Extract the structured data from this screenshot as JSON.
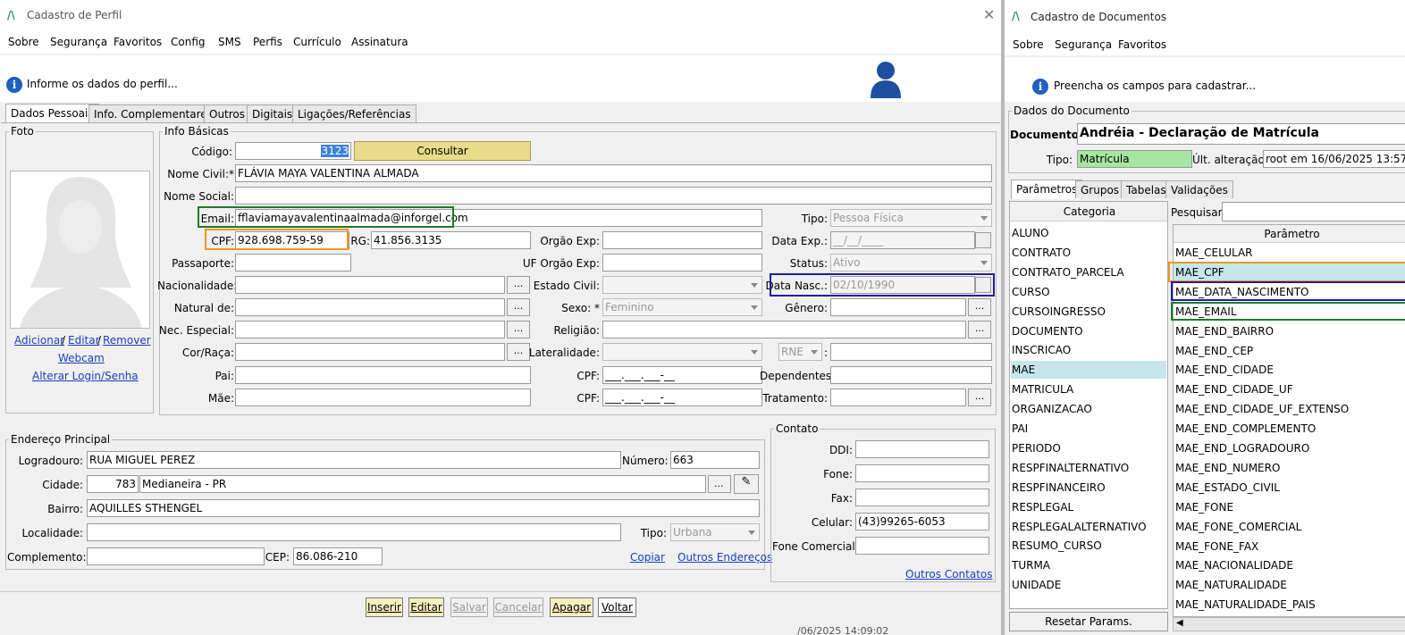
{
  "left": {
    "title": "Cadastro de Perfil",
    "menu": [
      "Sobre",
      "Segurança",
      "Favoritos",
      "Config",
      "SMS",
      "Perfis",
      "Currículo",
      "Assinatura"
    ],
    "info": "Informe os dados do perfil...",
    "tabs": [
      "Dados Pessoais",
      "Info. Complementares",
      "Outros",
      "Digitais",
      "Ligações/Referências"
    ],
    "foto": {
      "label": "Foto",
      "adicionar": "Adicionar",
      "editar": "Editar",
      "remover": "Remover",
      "sep": "/",
      "webcam": "Webcam",
      "alterar": "Alterar Login/Senha"
    },
    "info_basicas": {
      "label": "Info Básicas",
      "codigo_label": "Código:",
      "codigo": "3123",
      "consultar": "Consultar",
      "nome_civil_label": "Nome Civil:*",
      "nome_civil": "FLÁVIA MAYA VALENTINA ALMADA",
      "nome_social_label": "Nome Social:",
      "nome_social": "",
      "email_label": "Email:",
      "email": "fflaviamayavalentinaalmada@inforgel.com",
      "tipo_label": "Tipo:",
      "tipo": "Pessoa Física",
      "cpf_label": "CPF:",
      "cpf": "928.698.759-59",
      "rg_label": "RG:",
      "rg": "41.856.3135",
      "orgao_exp_label": "Orgão Exp:",
      "orgao_exp": "",
      "data_exp_label": "Data Exp.:",
      "data_exp": "__/__/____",
      "passaporte_label": "Passaporte:",
      "passaporte": "",
      "uf_orgao_label": "UF Orgão Exp:",
      "uf_orgao": "",
      "status_label": "Status:",
      "status": "Ativo",
      "nacionalidade_label": "Nacionalidade:",
      "nacionalidade": "",
      "estado_civil_label": "Estado Civil:",
      "estado_civil": "",
      "data_nasc_label": "Data Nasc.:",
      "data_nasc": "02/10/1990",
      "natural_label": "Natural de:",
      "natural": "",
      "sexo_label": "Sexo: *",
      "sexo": "Feminino",
      "genero_label": "Gênero:",
      "genero": "",
      "nec_label": "Nec. Especial:",
      "nec": "",
      "religiao_label": "Religião:",
      "religiao": "",
      "cor_label": "Cor/Raça:",
      "cor": "",
      "lateralidade_label": "Lateralidade:",
      "lateralidade": "",
      "rne": "RNE",
      "rne_sep": ":",
      "pai_label": "Pai:",
      "pai": "",
      "cpf2_label": "CPF:",
      "cpf_mask": "___.___.___-__",
      "dependentes_label": "Dependentes:",
      "mae_label": "Mãe:",
      "mae": "",
      "cpf3_label": "CPF:",
      "tratamento_label": "Tratamento:",
      "dots": "..."
    },
    "endereco": {
      "label": "Endereço Principal",
      "logradouro_label": "Logradouro:",
      "logradouro": "RUA MIGUEL PEREZ",
      "numero_label": "Número:",
      "numero": "663",
      "cidade_label": "Cidade:",
      "cidade_cod": "783",
      "cidade": "Medianeira - PR",
      "bairro_label": "Bairro:",
      "bairro": "AQUILLES STHENGEL",
      "localidade_label": "Localidade:",
      "localidade": "",
      "tipo_label": "Tipo:",
      "tipo": "Urbana",
      "complemento_label": "Complemento:",
      "complemento": "",
      "cep_label": "CEP:",
      "cep": "86.086-210",
      "copiar": "Copiar",
      "outros": "Outros Endereços"
    },
    "contato": {
      "label": "Contato",
      "ddi_label": "DDI:",
      "ddi": "",
      "fone_label": "Fone:",
      "fone": "",
      "fax_label": "Fax:",
      "fax": "",
      "celular_label": "Celular:",
      "celular": "(43)99265-6053",
      "fone_com_label": "Fone Comercial:",
      "fone_com": "",
      "outros": "Outros Contatos"
    },
    "buttons": [
      "Inserir",
      "Editar",
      "Salvar",
      "Cancelar",
      "Apagar",
      "Voltar"
    ],
    "status_fragment": "/06/2025 14:09:02"
  },
  "right": {
    "title": "Cadastro de Documentos",
    "menu": [
      "Sobre",
      "Segurança",
      "Favoritos"
    ],
    "info": "Preencha os campos para cadastrar...",
    "dados_label": "Dados do Documento",
    "documento_label": "Documento:",
    "documento": "Andréia - Declaração de Matrícula",
    "tipo_label": "Tipo:",
    "tipo": "Matrícula",
    "ult_label": "Últ. alteração:",
    "ult": "root em 16/06/2025 13:57",
    "tabs": [
      "Parâmetros",
      "Grupos",
      "Tabelas",
      "Validações"
    ],
    "categoria_header": "Categoria",
    "categorias": [
      "ALUNO",
      "CONTRATO",
      "CONTRATO_PARCELA",
      "CURSO",
      "CURSOINGRESSO",
      "DOCUMENTO",
      "INSCRICAO",
      "MAE",
      "MATRICULA",
      "ORGANIZACAO",
      "PAI",
      "PERIODO",
      "RESPFINALTERNATIVO",
      "RESPFINANCEIRO",
      "RESPLEGAL",
      "RESPLEGALALTERNATIVO",
      "RESUMO_CURSO",
      "TURMA",
      "UNIDADE"
    ],
    "pesquisar_label": "Pesquisar:",
    "parametro_header": "Parâmetro",
    "parametros": [
      "MAE_CELULAR",
      "MAE_CPF",
      "MAE_DATA_NASCIMENTO",
      "MAE_EMAIL",
      "MAE_END_BAIRRO",
      "MAE_END_CEP",
      "MAE_END_CIDADE",
      "MAE_END_CIDADE_UF",
      "MAE_END_CIDADE_UF_EXTENSO",
      "MAE_END_COMPLEMENTO",
      "MAE_END_LOGRADOURO",
      "MAE_END_NUMERO",
      "MAE_ESTADO_CIVIL",
      "MAE_FONE",
      "MAE_FONE_COMERCIAL",
      "MAE_FONE_FAX",
      "MAE_NACIONALIDADE",
      "MAE_NATURALIDADE",
      "MAE_NATURALIDADE_PAIS"
    ],
    "resetar": "Resetar Params."
  },
  "colors": {
    "orange": "#f0961e",
    "blue": "#1e1ea0",
    "green": "#1e7a2a",
    "consultar": "#e8dc8a",
    "tipo_green": "#a6e6a0",
    "selected": "#c6e6ea"
  }
}
